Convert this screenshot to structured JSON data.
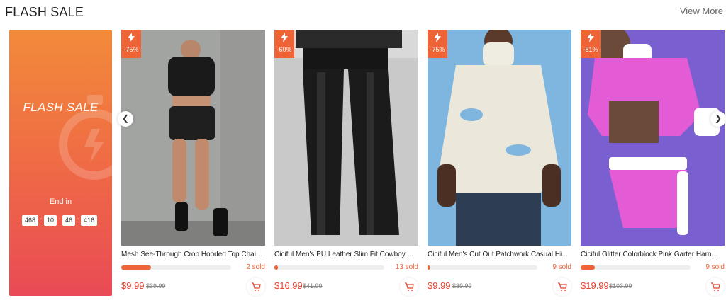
{
  "header": {
    "title": "FLASH SALE",
    "view_more": "View More"
  },
  "promo": {
    "title": "FLASH SALE",
    "end_label": "End in",
    "timer": [
      "468",
      "10",
      "46",
      "416"
    ],
    "gradient": [
      "#f28b3a",
      "#ef6b45",
      "#e94a55"
    ]
  },
  "accent_color": "#ef6436",
  "products": [
    {
      "name": "Mesh See-Through Crop Hooded Top Chai...",
      "discount": "-75%",
      "sold": "2 sold",
      "sold_progress": 0.27,
      "price": "$9.99",
      "old_price": "$39.99"
    },
    {
      "name": "Ciciful Men's PU Leather Slim Fit Cowboy ...",
      "discount": "-60%",
      "sold": "13 sold",
      "sold_progress": 0.03,
      "price": "$16.99",
      "old_price": "$41.99"
    },
    {
      "name": "Ciciful Men's Cut Out Patchwork Casual Hi...",
      "discount": "-75%",
      "sold": "9 sold",
      "sold_progress": 0.02,
      "price": "$9.99",
      "old_price": "$39.99"
    },
    {
      "name": "Ciciful Glitter Colorblock Pink Garter Harn...",
      "discount": "-81%",
      "sold": "9 sold",
      "sold_progress": 0.13,
      "price": "$19.99",
      "old_price": "$103.99"
    }
  ],
  "icons": [
    "lightning-icon",
    "cart-icon",
    "chevron-left-icon",
    "chevron-right-icon",
    "stopwatch-icon"
  ]
}
